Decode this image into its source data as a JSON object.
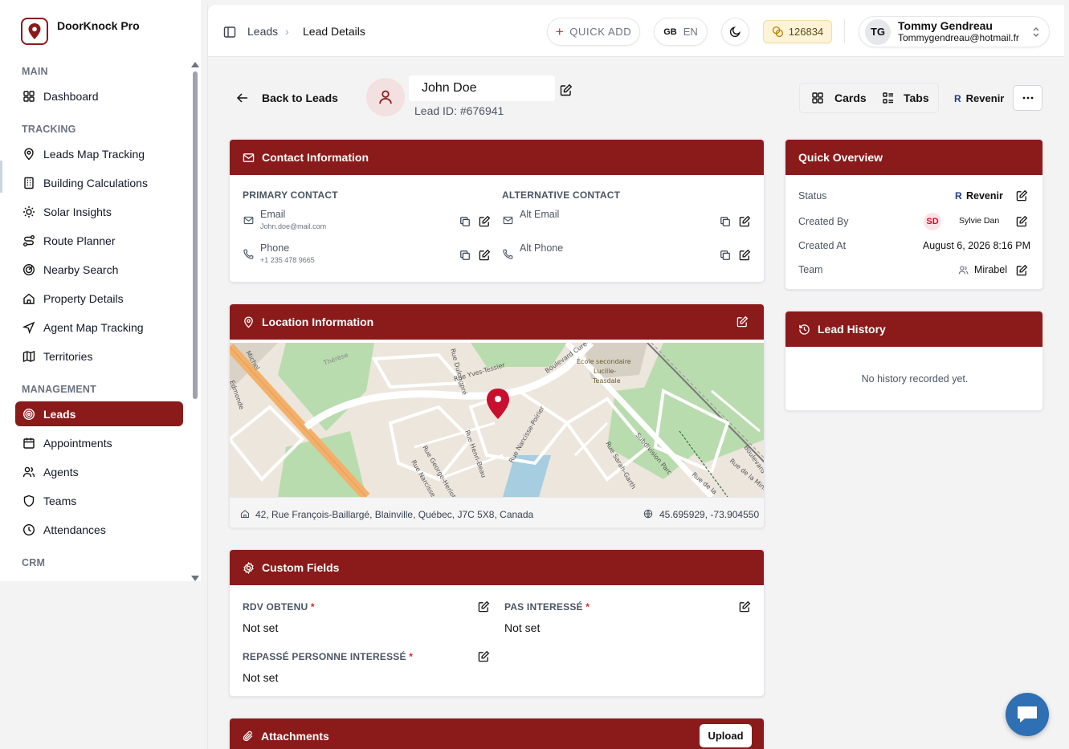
{
  "app": {
    "name": "DoorKnock Pro"
  },
  "sidebar": {
    "sections": {
      "main": "MAIN",
      "tracking": "TRACKING",
      "management": "MANAGEMENT",
      "crm": "CRM"
    },
    "items": [
      {
        "label": "Dashboard",
        "icon": "grid-icon"
      },
      {
        "label": "Leads Map Tracking",
        "icon": "map-pin-icon"
      },
      {
        "label": "Building Calculations",
        "icon": "building-icon"
      },
      {
        "label": "Solar Insights",
        "icon": "sun-icon"
      },
      {
        "label": "Route Planner",
        "icon": "route-icon"
      },
      {
        "label": "Nearby Search",
        "icon": "radar-icon"
      },
      {
        "label": "Property Details",
        "icon": "home-icon"
      },
      {
        "label": "Agent Map Tracking",
        "icon": "navigation-icon"
      },
      {
        "label": "Territories",
        "icon": "map-icon"
      },
      {
        "label": "Leads",
        "icon": "target-icon",
        "active": true
      },
      {
        "label": "Appointments",
        "icon": "calendar-icon"
      },
      {
        "label": "Agents",
        "icon": "users-icon"
      },
      {
        "label": "Teams",
        "icon": "shield-icon"
      },
      {
        "label": "Attendances",
        "icon": "clock-icon"
      }
    ]
  },
  "topbar": {
    "breadcrumb": [
      "Leads",
      "Lead Details"
    ],
    "quick_add": "QUICK ADD",
    "lang_flag": "GB",
    "lang": "EN",
    "credits": "126834",
    "user": {
      "initials": "TG",
      "name": "Tommy Gendreau",
      "email": "Tommygendreau@hotmail.fr"
    }
  },
  "lead_header": {
    "back": "Back to Leads",
    "name": "John Doe",
    "lead_id": "Lead ID: #676941",
    "view_cards": "Cards",
    "view_tabs": "Tabs",
    "status_letter": "R",
    "status": "Revenir"
  },
  "contact": {
    "title": "Contact Information",
    "primary_heading": "PRIMARY CONTACT",
    "alt_heading": "ALTERNATIVE CONTACT",
    "email_label": "Email",
    "email_value": "John.doe@mail.com",
    "phone_label": "Phone",
    "phone_value": "+1 235 478 9665",
    "alt_email_label": "Alt Email",
    "alt_phone_label": "Alt Phone"
  },
  "location": {
    "title": "Location Information",
    "address": "42, Rue François-Baillargé, Blainville, Québec, J7C 5X8, Canada",
    "coords": "45.695929, -73.904550",
    "map_labels": [
      "Rue Yves-Tessier",
      "Boulevard Curé-Labelle",
      "École secondaire",
      "Lucille-",
      "Teasdale",
      "Rue Henri-Beau",
      "Rue Narcisse-Poirier",
      "Rue George-Heriot",
      "Rue Narcisse-P",
      "Subdivision Parc",
      "Rue Sarah-Garth",
      "Boulevard",
      "Rue de la Mine",
      "Rue de la",
      "Rue Dulongpré",
      "Thérèse",
      "Michel",
      "Edmonde"
    ]
  },
  "custom_fields": {
    "title": "Custom Fields",
    "fields": [
      {
        "label": "RDV OBTENU",
        "value": "Not set"
      },
      {
        "label": "PAS INTERESSÉ",
        "value": "Not set"
      },
      {
        "label": "REPASSÉ PERSONNE INTERESSÉ",
        "value": "Not set"
      }
    ],
    "required_mark": "*"
  },
  "attachments": {
    "title": "Attachments",
    "upload": "Upload"
  },
  "overview": {
    "title": "Quick Overview",
    "status_label": "Status",
    "status_letter": "R",
    "status_value": "Revenir",
    "created_by_label": "Created By",
    "created_by_initials": "SD",
    "created_by_value": "Sylvie Dan",
    "created_at_label": "Created At",
    "created_at_value": "August 6, 2026 8:16 PM",
    "team_label": "Team",
    "team_value": "Mirabel"
  },
  "history": {
    "title": "Lead History",
    "empty": "No history recorded yet."
  },
  "colors": {
    "brand": "#8b1a1a",
    "accent_pin": "#c8102e",
    "credits_bg": "#fdf3d7"
  }
}
